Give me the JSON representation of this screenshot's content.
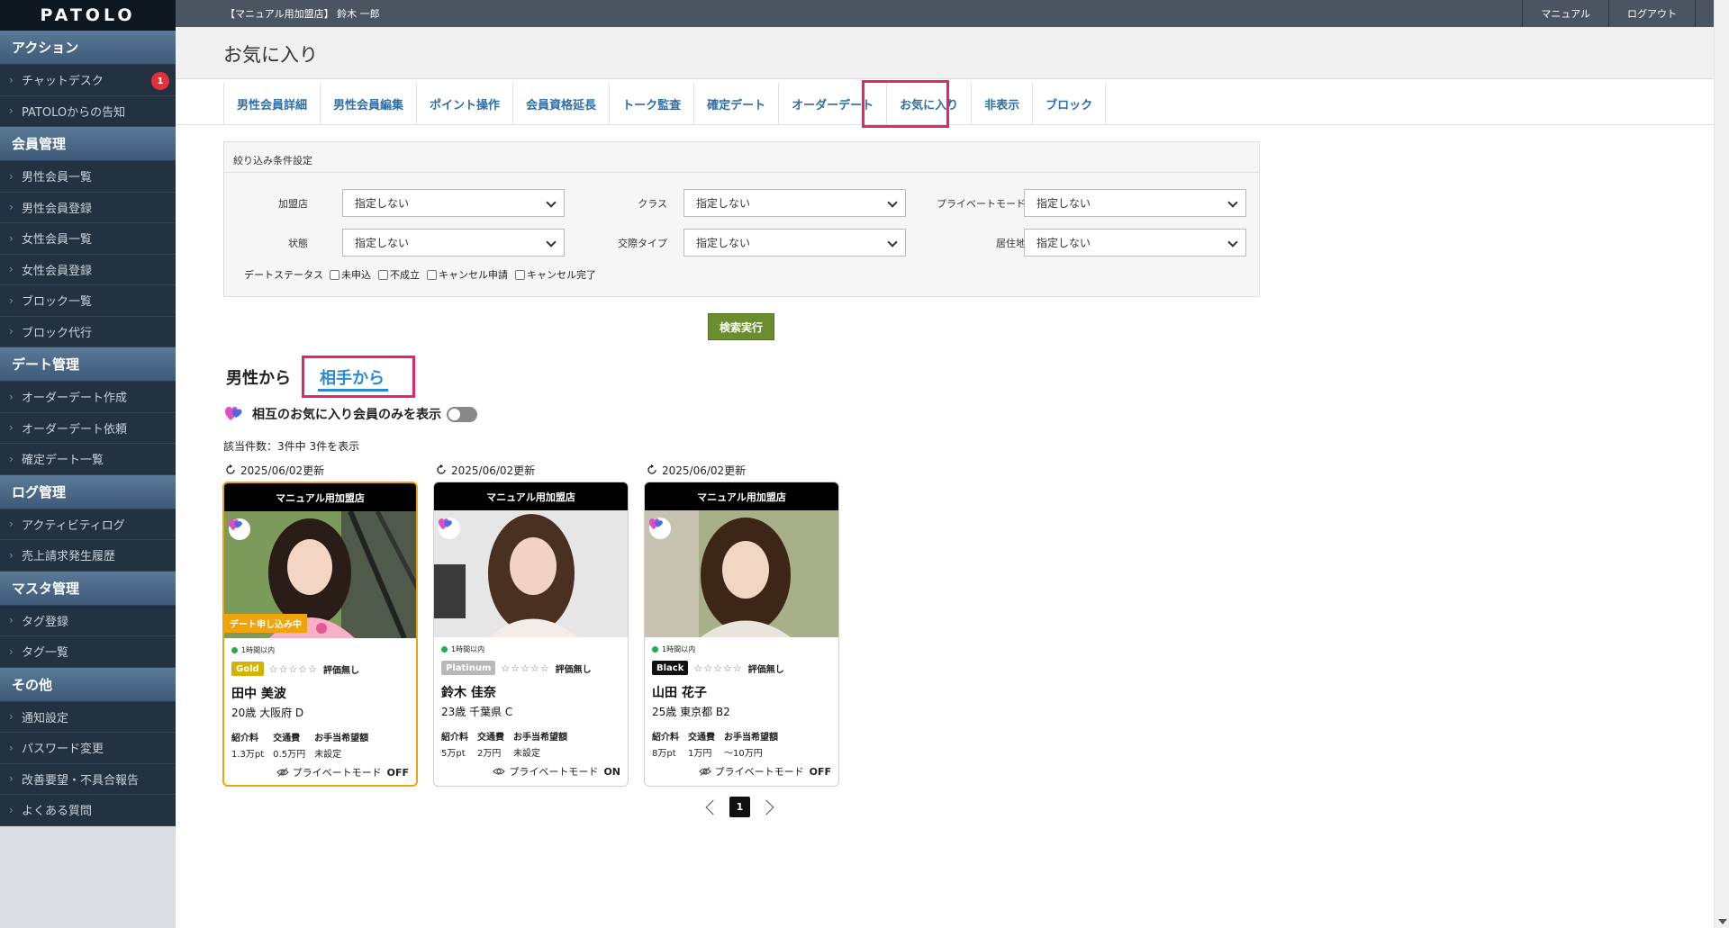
{
  "sidebar": {
    "logo": "PATOLO",
    "sections": [
      {
        "title": "アクション",
        "items": [
          {
            "label": "チャットデスク",
            "badge": "1"
          },
          {
            "label": "PATOLOからの告知"
          }
        ]
      },
      {
        "title": "会員管理",
        "items": [
          {
            "label": "男性会員一覧"
          },
          {
            "label": "男性会員登録"
          },
          {
            "label": "女性会員一覧"
          },
          {
            "label": "女性会員登録"
          },
          {
            "label": "ブロック一覧"
          },
          {
            "label": "ブロック代行"
          }
        ]
      },
      {
        "title": "デート管理",
        "items": [
          {
            "label": "オーダーデート作成"
          },
          {
            "label": "オーダーデート依頼"
          },
          {
            "label": "確定デート一覧"
          }
        ]
      },
      {
        "title": "ログ管理",
        "items": [
          {
            "label": "アクティビティログ"
          },
          {
            "label": "売上請求発生履歴"
          }
        ]
      },
      {
        "title": "マスタ管理",
        "items": [
          {
            "label": "タグ登録"
          },
          {
            "label": "タグ一覧"
          }
        ]
      },
      {
        "title": "その他",
        "items": [
          {
            "label": "通知設定"
          },
          {
            "label": "パスワード変更"
          },
          {
            "label": "改善要望・不具合報告"
          },
          {
            "label": "よくある質問"
          }
        ]
      }
    ]
  },
  "topbar": {
    "user": "【マニュアル用加盟店】 鈴木 一郎",
    "manual": "マニュアル",
    "logout": "ログアウト"
  },
  "page": {
    "title": "お気に入り"
  },
  "tabs": [
    {
      "label": "男性会員詳細"
    },
    {
      "label": "男性会員編集"
    },
    {
      "label": "ポイント操作"
    },
    {
      "label": "会員資格延長"
    },
    {
      "label": "トーク監査"
    },
    {
      "label": "確定デート"
    },
    {
      "label": "オーダーデート"
    },
    {
      "label": "お気に入り",
      "active": true
    },
    {
      "label": "非表示"
    },
    {
      "label": "ブロック"
    }
  ],
  "filter": {
    "title": "絞り込み条件設定",
    "labels": {
      "store": "加盟店",
      "class": "クラス",
      "private_mode": "プライベートモード",
      "status": "状態",
      "relation_type": "交際タイプ",
      "residence": "居住地",
      "date_status": "デートステータス"
    },
    "values": {
      "store": "指定しない",
      "class": "指定しない",
      "private_mode": "指定しない",
      "status": "指定しない",
      "relation_type": "指定しない",
      "residence": "指定しない"
    },
    "checkboxes": [
      "未申込",
      "不成立",
      "キャンセル申請",
      "キャンセル完了"
    ],
    "search_button": "検索実行"
  },
  "direction": {
    "from_male": "男性から",
    "from_partner": "相手から",
    "active": "相手から"
  },
  "mutual_toggle": {
    "label": "相互のお気に入り会員のみを表示",
    "on": false
  },
  "result_count": "該当件数：3件中 3件を表示",
  "cards": [
    {
      "updated": "2025/06/02更新",
      "store": "マニュアル用加盟店",
      "banner": "デート申し込み中",
      "online": "1時間以内",
      "rank": "Gold",
      "rank_color": "#d4b300",
      "stars": "☆☆☆☆☆",
      "evaluation": "評価無し",
      "name": "田中 美波",
      "age_loc": "20歳  大阪府  D",
      "fee_labels": [
        "紹介料",
        "交通費",
        "お手当希望額"
      ],
      "fee_values": [
        "1.3万pt",
        "0.5万円",
        "未設定"
      ],
      "private_label": "プライベートモード",
      "private_state": "OFF"
    },
    {
      "updated": "2025/06/02更新",
      "store": "マニュアル用加盟店",
      "online": "1時間以内",
      "rank": "Platinum",
      "rank_color": "#b8b8b8",
      "stars": "☆☆☆☆☆",
      "evaluation": "評価無し",
      "name": "鈴木 佳奈",
      "age_loc": "23歳  千葉県  C",
      "fee_labels": [
        "紹介料",
        "交通費",
        "お手当希望額"
      ],
      "fee_values": [
        "5万pt",
        "2万円",
        "未設定"
      ],
      "private_label": "プライベートモード",
      "private_state": "ON"
    },
    {
      "updated": "2025/06/02更新",
      "store": "マニュアル用加盟店",
      "online": "1時間以内",
      "rank": "Black",
      "rank_color": "#111111",
      "stars": "☆☆☆☆☆",
      "evaluation": "評価無し",
      "name": "山田 花子",
      "age_loc": "25歳  東京都  B2",
      "fee_labels": [
        "紹介料",
        "交通費",
        "お手当希望額"
      ],
      "fee_values": [
        "8万pt",
        "1万円",
        "〜10万円"
      ],
      "private_label": "プライベートモード",
      "private_state": "OFF"
    }
  ],
  "pagination": {
    "current": "1"
  }
}
